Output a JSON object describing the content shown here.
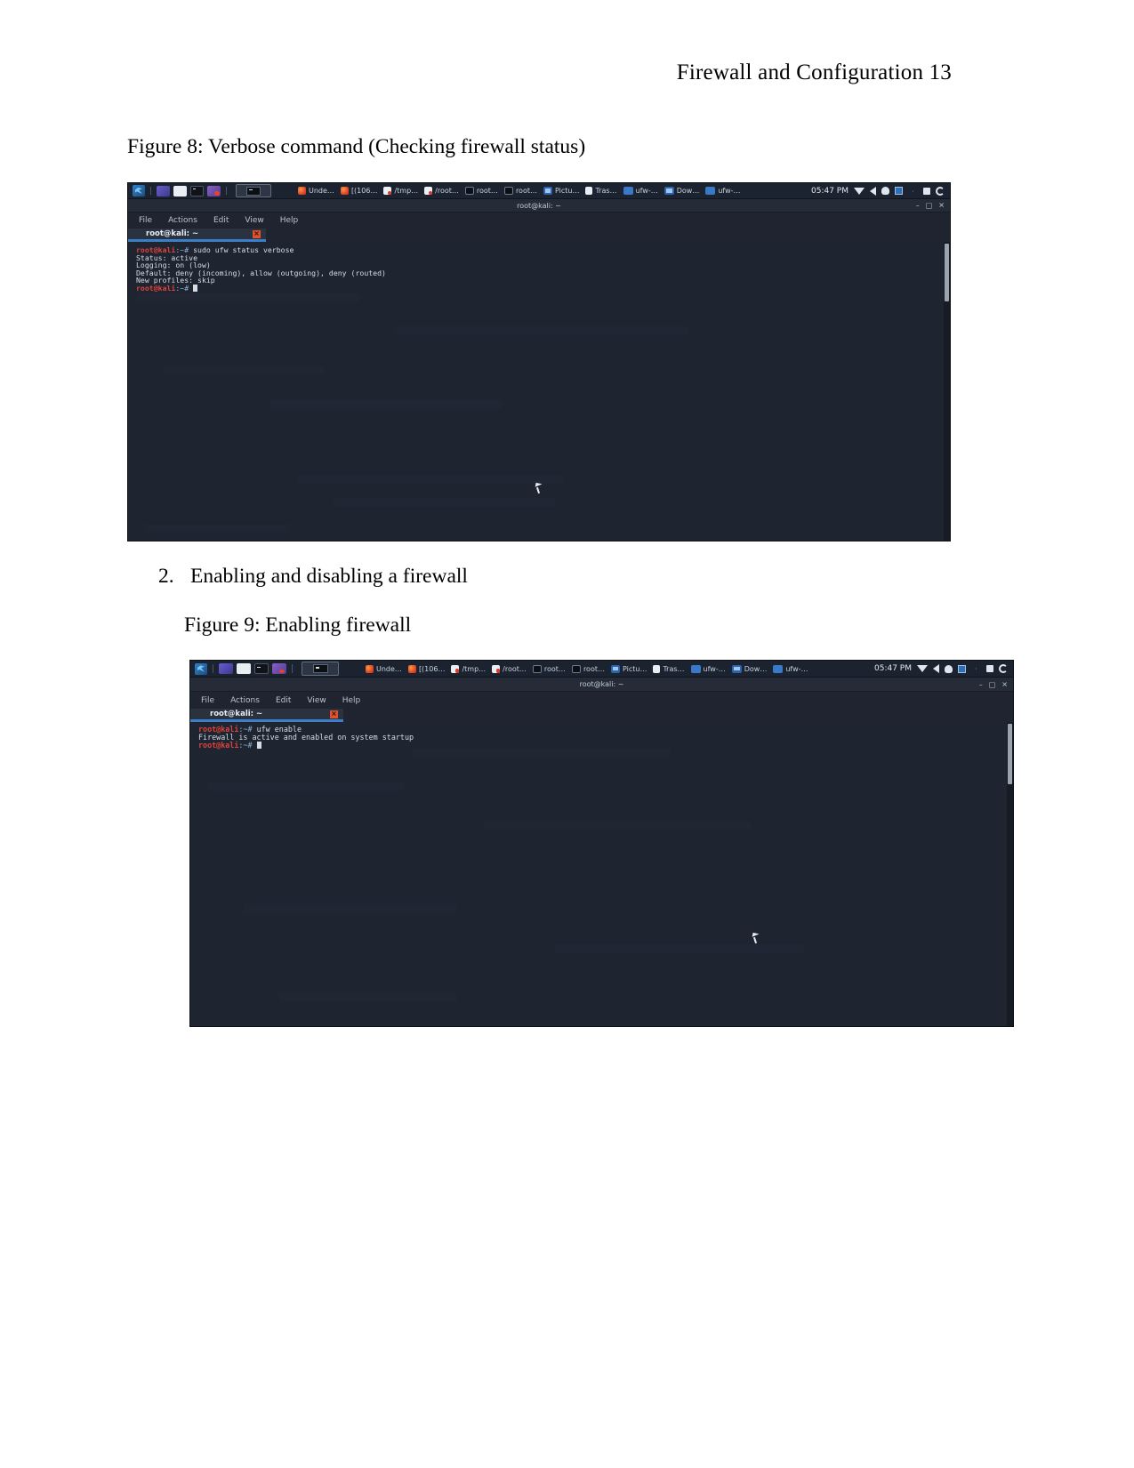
{
  "document": {
    "header": "Firewall and Configuration 13",
    "figure8_caption": "Figure 8: Verbose command (Checking firewall status)",
    "list_item_2_number": "2.",
    "list_item_2_text": "Enabling and disabling a firewall",
    "figure9_caption": "Figure 9: Enabling firewall"
  },
  "screenshot1": {
    "taskbar": {
      "launcher_icons": [
        "kali-menu-icon",
        "workspace-switcher-icon",
        "files-icon",
        "terminal-icon",
        "browser-icon"
      ],
      "active_task_icon": "terminal-icon",
      "windows": [
        {
          "icon": "firefox-icon",
          "label": "Unde…"
        },
        {
          "icon": "firefox-icon",
          "label": "[(106…"
        },
        {
          "icon": "document-icon",
          "label": "/tmp…"
        },
        {
          "icon": "document-icon",
          "label": "/root…"
        },
        {
          "icon": "terminal-icon",
          "label": "root…"
        },
        {
          "icon": "terminal-icon",
          "label": "root…"
        },
        {
          "icon": "folder-icon",
          "label": "Pictu…"
        },
        {
          "icon": "trash-icon",
          "label": "Tras…"
        },
        {
          "icon": "folder-icon",
          "label": "ufw-…"
        },
        {
          "icon": "folder-icon",
          "label": "Dow…"
        },
        {
          "icon": "folder-icon",
          "label": "ufw-…"
        }
      ],
      "clock": "05:47 PM",
      "tray_icons": [
        "network-icon",
        "volume-icon",
        "notification-bell-icon",
        "clipboard-icon",
        "lock-icon",
        "power-icon"
      ]
    },
    "window": {
      "title": "root@kali: ~",
      "controls": {
        "minimize": "–",
        "maximize": "□",
        "close": "✕"
      },
      "menu": [
        "File",
        "Actions",
        "Edit",
        "View",
        "Help"
      ],
      "tab_label": "root@kali: ~",
      "tab_close": "×"
    },
    "terminal": {
      "prompt_user": "root@kali",
      "prompt_sep": ":~# ",
      "command": "sudo ufw status verbose",
      "output": [
        "Status: active",
        "Logging: on (low)",
        "Default: deny (incoming), allow (outgoing), deny (routed)",
        "New profiles: skip"
      ]
    }
  },
  "screenshot2": {
    "taskbar": {
      "launcher_icons": [
        "kali-menu-icon",
        "workspace-switcher-icon",
        "files-icon",
        "terminal-icon",
        "browser-icon"
      ],
      "active_task_icon": "terminal-icon",
      "windows": [
        {
          "icon": "firefox-icon",
          "label": "Unde…"
        },
        {
          "icon": "firefox-icon",
          "label": "[(106…"
        },
        {
          "icon": "document-icon",
          "label": "/tmp…"
        },
        {
          "icon": "document-icon",
          "label": "/root…"
        },
        {
          "icon": "terminal-icon",
          "label": "root…"
        },
        {
          "icon": "terminal-icon",
          "label": "root…"
        },
        {
          "icon": "folder-icon",
          "label": "Pictu…"
        },
        {
          "icon": "trash-icon",
          "label": "Tras…"
        },
        {
          "icon": "folder-icon",
          "label": "ufw-…"
        },
        {
          "icon": "folder-icon",
          "label": "Dow…"
        },
        {
          "icon": "folder-icon",
          "label": "ufw-…"
        }
      ],
      "clock": "05:47 PM",
      "tray_icons": [
        "network-icon",
        "volume-icon",
        "notification-bell-icon",
        "clipboard-icon",
        "lock-icon",
        "power-icon"
      ]
    },
    "window": {
      "title": "root@kali: ~",
      "controls": {
        "minimize": "–",
        "maximize": "□",
        "close": "✕"
      },
      "menu": [
        "File",
        "Actions",
        "Edit",
        "View",
        "Help"
      ],
      "tab_label": "root@kali: ~",
      "tab_close": "×"
    },
    "terminal": {
      "prompt_user": "root@kali",
      "prompt_sep": ":~# ",
      "command": "ufw enable",
      "output": [
        "Firewall is active and enabled on system startup"
      ]
    }
  },
  "colors": {
    "terminal_bg": "#1e2430",
    "taskbar_bg": "#1b2330",
    "accent_blue": "#3d7ec9",
    "prompt_red": "#e0433c",
    "close_orange": "#e0522b"
  }
}
